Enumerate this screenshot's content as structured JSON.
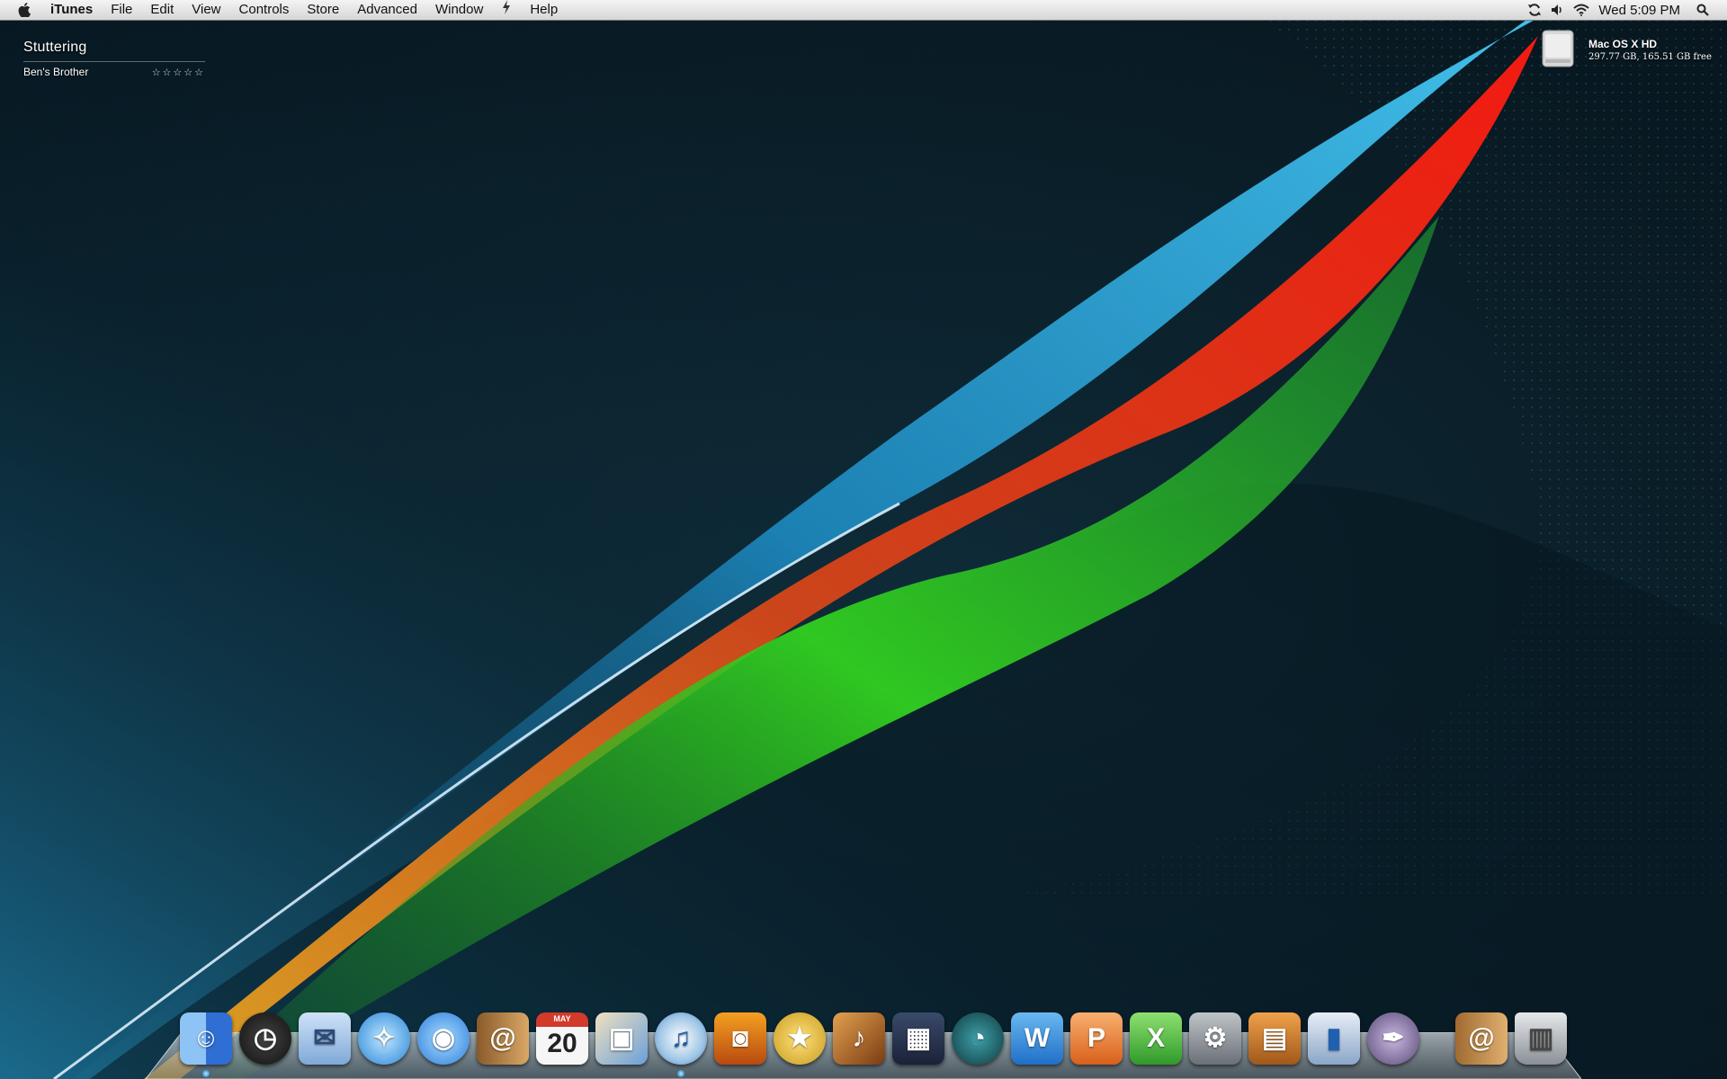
{
  "menubar": {
    "apple_icon": "apple-icon",
    "app_name": "iTunes",
    "menus": [
      "File",
      "Edit",
      "View",
      "Controls",
      "Store",
      "Advanced",
      "Window",
      "Help"
    ],
    "script_icon": "script-menu-icon",
    "extras": [
      "sync-icon",
      "volume-icon",
      "wifi-icon"
    ],
    "clock": "Wed 5:09 PM",
    "spotlight_icon": "spotlight-icon"
  },
  "now_playing": {
    "title": "Stuttering",
    "artist": "Ben's Brother",
    "rating_display": "☆☆☆☆☆"
  },
  "desktop": {
    "hard_drive": {
      "name": "Mac OS X HD",
      "info": "297.77 GB, 165.51 GB free",
      "icon": "hard-drive-icon"
    }
  },
  "dock": {
    "items": [
      {
        "name": "finder",
        "icon": "finder-icon",
        "running": true
      },
      {
        "name": "dashboard",
        "icon": "dashboard-icon",
        "running": false
      },
      {
        "name": "mail",
        "icon": "mail-icon",
        "running": false
      },
      {
        "name": "safari",
        "icon": "safari-icon",
        "running": false
      },
      {
        "name": "ichat",
        "icon": "ichat-icon",
        "running": false
      },
      {
        "name": "address-book",
        "icon": "address-book-icon",
        "running": false
      },
      {
        "name": "ical",
        "icon": "ical-icon",
        "running": false,
        "text": "20",
        "subtext": "MAY"
      },
      {
        "name": "iphoto",
        "icon": "iphoto-icon",
        "running": false
      },
      {
        "name": "itunes",
        "icon": "itunes-icon",
        "running": true
      },
      {
        "name": "image-capture",
        "icon": "image-capture-icon",
        "running": false
      },
      {
        "name": "imovie",
        "icon": "imovie-icon",
        "running": false
      },
      {
        "name": "garageband",
        "icon": "garageband-icon",
        "running": false
      },
      {
        "name": "spaces",
        "icon": "spaces-icon",
        "running": false
      },
      {
        "name": "time-machine",
        "icon": "time-machine-icon",
        "running": false
      },
      {
        "name": "word",
        "icon": "word-icon",
        "running": false
      },
      {
        "name": "powerpoint",
        "icon": "powerpoint-icon",
        "running": false
      },
      {
        "name": "excel",
        "icon": "excel-icon",
        "running": false
      },
      {
        "name": "system-preferences",
        "icon": "system-preferences-icon",
        "running": false
      },
      {
        "name": "keynote",
        "icon": "keynote-icon",
        "running": false
      },
      {
        "name": "numbers",
        "icon": "numbers-icon",
        "running": false
      },
      {
        "name": "script-editor",
        "icon": "script-editor-icon",
        "running": false
      },
      {
        "name": "documents-stack",
        "icon": "documents-stack-icon",
        "running": false
      },
      {
        "name": "trash",
        "icon": "trash-icon",
        "running": false
      }
    ]
  },
  "colors": {
    "background_dark": "#0a1a24",
    "ribbon_blue": "#2aa6e0",
    "ribbon_red": "#e0201a",
    "ribbon_green": "#3ad42a",
    "menubar_bg": "#e4e4e4"
  }
}
